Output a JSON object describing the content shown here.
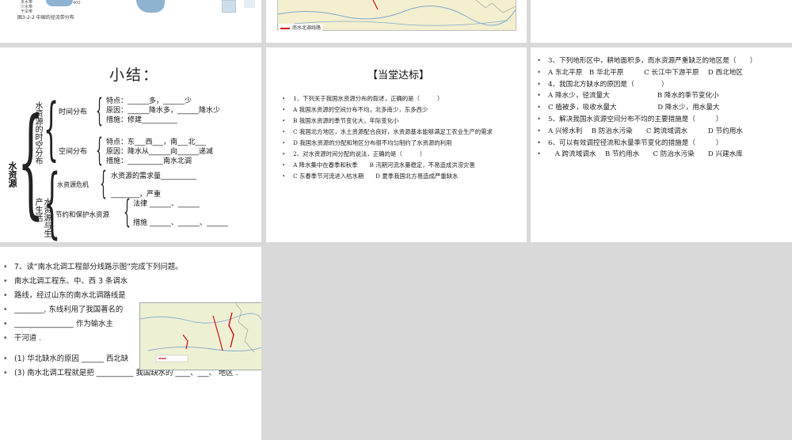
{
  "slide1": {
    "legend_lines": [
      "多水带",
      "少水带",
      "干旱带"
    ],
    "legend_value": "400",
    "caption": "图3-2-2 中国的径流带分布"
  },
  "slide2": {
    "map_legend": "南水北调线路"
  },
  "slide4": {
    "title": "小结：",
    "root": "水资源",
    "branch1": "水资源的时空分布",
    "time_dist": "时间分布",
    "time_feature": "特点：______多，______少",
    "time_cause": "原因：______降水多，______降水少",
    "time_measure": "措施：修建__________",
    "space_dist": "空间分布",
    "space_feature": "特点：东___西___，南___北___",
    "space_cause": "原因：降水从______向______递减",
    "space_measure": "措施：__________南水北调",
    "branch2": "水资源与生产生活",
    "crisis": "水资源危机",
    "crisis_line1": "水资源的需求量__________",
    "crisis_line2": "________，严重",
    "protect": "节约和保护水资源",
    "law": "法律 ______、______",
    "measures": "措施 ______、______、______"
  },
  "slide5": {
    "title": "【当堂达标】",
    "items": [
      "1、下列关于我国水资源分布的叙述，正确的是（　　　）",
      "A 我国水资源的空间分布不均，北多南少，东多西少",
      "B 我国水资源的季节变化大，年际变化小",
      "C 我国北方地区，水土资源配合良好，水资源基本能够满足工农业生产的需求",
      "D 我国水资源的分配和地区分布很不均匀制约了水资源的利用",
      "2、对水资源时间分配的说法，正确的是（　　　）",
      "A 降水集中在春季和秋季　　B 汛期河流水量稳定，不易造成洪涝灾害",
      "C 东春季节河流进入枯水期　　D 夏季我国北方易造成严重缺水"
    ]
  },
  "slide6": {
    "items": [
      "3、下列地形区中，耕地面积多，而水资源严重缺乏的地区是（　　）",
      "A 东北平原　B 华北平原　　　C 长江中下游平原　 D 西北地区",
      "4、我国北方缺水的原因是（　　　　）",
      "A 降水少，径流量大　　　　　　　B 降水的季节变化小",
      "C 植被多，吸收水量大　　　　　　D 降水少，用水量大",
      "5、解决我国水资源空间分布不均的主要措施是（　　　）",
      "A 兴修水利　 B 防治水污染　　C 跨流域调水　　　D 节约用水",
      "6、可以有效调控径流和水量季节变化的措施是（　　　）",
      "　A 跨流域调水　 B 节约用水　　C 防治水污染　　D 兴建水库"
    ]
  },
  "slide7": {
    "items": [
      "7、读“南水北调工程部分线路示图”完成下列问题。",
      "南水北调工程东、中、西 3 条调水",
      "路线，经过山东的南水北调路线是",
      "________, 东线利用了我国著名的",
      "________________ 作为输水主",
      "干河道 ."
    ],
    "items2": [
      "(1) 华北缺水的原因 ______ 西北缺",
      "(3) 南水北调工程就是把 __________ 我国缺水的 ____、___、 地区 ."
    ]
  }
}
